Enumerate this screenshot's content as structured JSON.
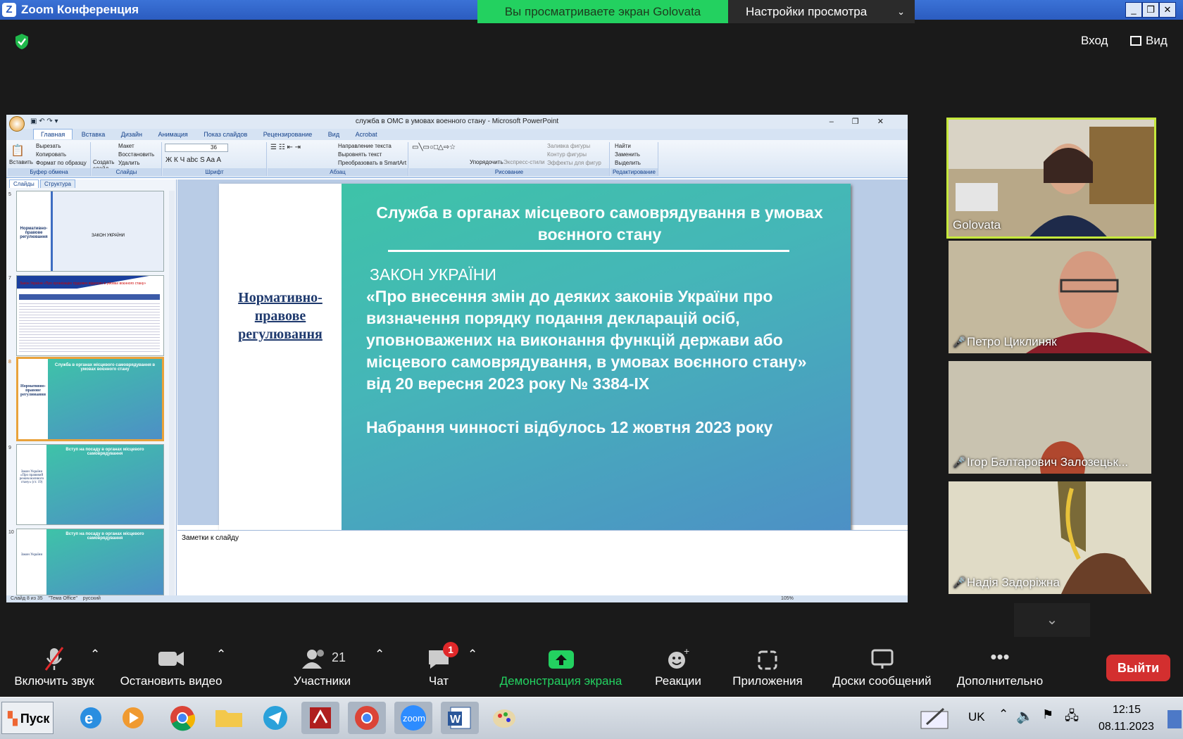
{
  "window": {
    "title": "Zoom Конференция",
    "logo": "Z"
  },
  "share_banner": {
    "text": "Вы просматриваете экран Golovata",
    "view_options": "Настройки просмотра"
  },
  "top_right": {
    "enter": "Вход",
    "view": "Вид"
  },
  "ppt": {
    "title": "служба в ОМС в умовах военного стану - Microsoft PowerPoint",
    "tabs": [
      "Главная",
      "Вставка",
      "Дизайн",
      "Анимация",
      "Показ слайдов",
      "Рецензирование",
      "Вид",
      "Acrobat"
    ],
    "groups": {
      "clipboard": {
        "caption": "Буфер обмена",
        "paste": "Вставить",
        "cut": "Вырезать",
        "copy": "Копировать",
        "format": "Формат по образцу"
      },
      "slides": {
        "caption": "Слайды",
        "create": "Создать слайд",
        "layout": "Макет",
        "restore": "Восстановить",
        "delete": "Удалить"
      },
      "font": {
        "caption": "Шрифт",
        "size": "36"
      },
      "paragraph": {
        "caption": "Абзац",
        "dir": "Направление текста",
        "align": "Выровнять текст",
        "smartart": "Преобразовать в SmartArt"
      },
      "drawing": {
        "caption": "Рисование",
        "arrange": "Упорядочить",
        "quick": "Экспресс-стили",
        "fill": "Заливка фигуры",
        "outline": "Контур фигуры",
        "effects": "Эффекты для фигур"
      },
      "editing": {
        "caption": "Редактирование",
        "find": "Найти",
        "replace": "Заменить",
        "select": "Выделить"
      }
    },
    "panel_tabs": [
      "Слайды",
      "Структура"
    ],
    "thumbs": [
      {
        "num": "5",
        "label": "Нормативно-правове регулювання",
        "text": "ЗАКОН УКРАЇНИ"
      },
      {
        "num": "7",
        "label": "",
        "text": "Закон України «Про організацію трудових відносин в умовах воєнного стану»"
      },
      {
        "num": "8",
        "label": "Нормативно-правове регулювання",
        "text": "Служба в органах місцевого самоврядування в умовах воєнного стану"
      },
      {
        "num": "9",
        "label": "Закон України «Про правовий режим воєнного стану» (ст. 19)",
        "text": "Вступ на посаду в органах місцевого самоврядування"
      },
      {
        "num": "10",
        "label": "Закон України",
        "text": "Вступ на посаду в органах місцевого самоврядування"
      }
    ],
    "slide": {
      "left_label": "Нормативно-правове регулювання",
      "title": "Служба в органах місцевого самоврядування в умовах воєнного стану",
      "law_head": "ЗАКОН УКРАЇНИ",
      "law_body": "«Про внесення змін до деяких законів України про визначення порядку подання декларацій осіб, уповноважених на виконання функцій держави або місцевого самоврядування, в умовах воєнного стану» від 20 вересня 2023 року № 3384-ІХ",
      "effective": "Набрання чинності відбулось 12 жовтня 2023 року"
    },
    "notes": "Заметки к слайду",
    "status": {
      "slide": "Слайд 8 из 35",
      "theme": "\"Тема Office\"",
      "lang": "русский",
      "zoom": "105%"
    }
  },
  "participants": [
    {
      "name": "Golovata",
      "muted": false
    },
    {
      "name": "Петро Циклиняк",
      "muted": true
    },
    {
      "name": "Ігор Балтарович Залозецьк...",
      "muted": true
    },
    {
      "name": "Надія Задоріжна",
      "muted": true
    }
  ],
  "toolbar": {
    "audio": "Включить звук",
    "video": "Остановить видео",
    "participants": "Участники",
    "participants_count": "21",
    "chat": "Чат",
    "chat_badge": "1",
    "share": "Демонстрация экрана",
    "reactions": "Реакции",
    "apps": "Приложения",
    "whiteboards": "Доски сообщений",
    "more": "Дополнительно",
    "leave": "Выйти"
  },
  "taskbar": {
    "start": "Пуск",
    "lang": "UK",
    "time": "12:15",
    "date": "08.11.2023"
  },
  "colors": {
    "share_green": "#23d160",
    "leave_red": "#d32f2f",
    "active_border": "#c6e93c"
  }
}
